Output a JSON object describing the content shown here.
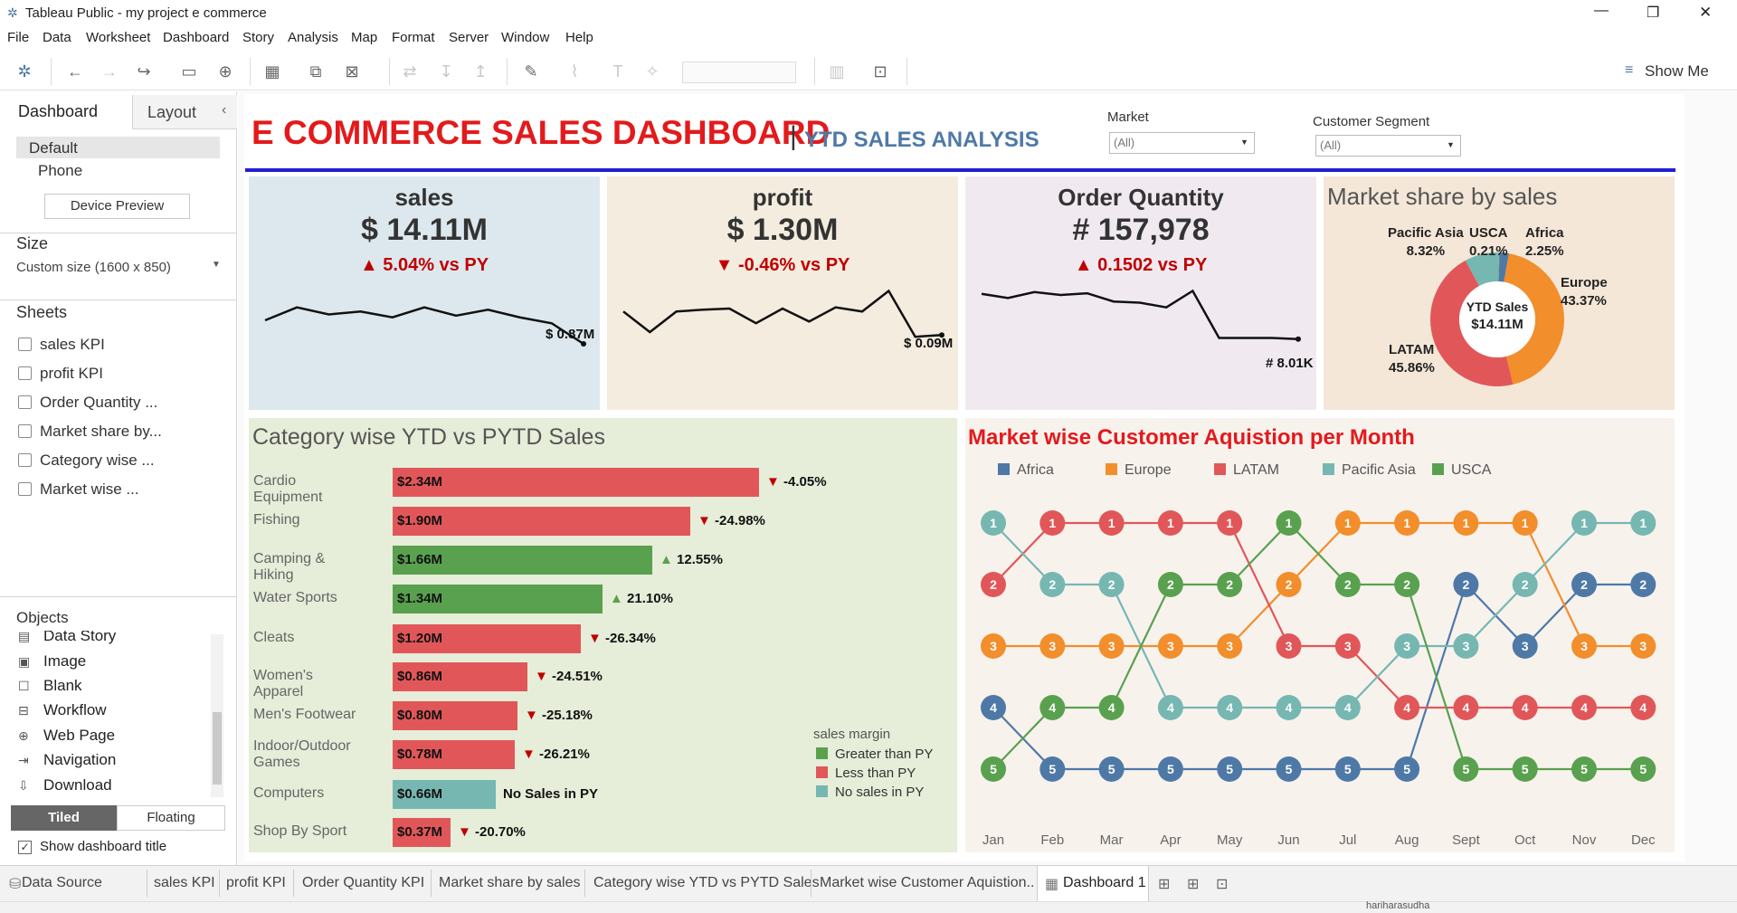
{
  "window": {
    "title": "Tableau Public - my project e commerce",
    "min": "—",
    "restore": "❐",
    "close": "✕"
  },
  "menu": [
    "File",
    "Data",
    "Worksheet",
    "Dashboard",
    "Story",
    "Analysis",
    "Map",
    "Format",
    "Server",
    "Window",
    "Help"
  ],
  "toolbar": {
    "show_me": "Show Me"
  },
  "left": {
    "tab_dashboard": "Dashboard",
    "tab_layout": "Layout",
    "collapse": "‹",
    "device_default": "Default",
    "device_phone": "Phone",
    "device_preview": "Device Preview",
    "size_header": "Size",
    "size_value": "Custom size (1600 x 850)",
    "sheets_header": "Sheets",
    "sheets": [
      "sales KPI",
      "profit KPI",
      "Order Quantity ...",
      "Market share by...",
      "Category wise ...",
      "Market wise ..."
    ],
    "objects_header": "Objects",
    "objects": [
      "Data Story",
      "Image",
      "Blank",
      "Workflow",
      "Web Page",
      "Navigation",
      "Download"
    ],
    "tiled": "Tiled",
    "floating": "Floating",
    "show_title": "Show dashboard title"
  },
  "dashboard": {
    "title": "E COMMERCE SALES DASHBOARD",
    "sep": "|",
    "subtitle": "YTD SALES ANALYSIS",
    "filter_market_label": "Market",
    "filter_market_value": "(All)",
    "filter_segment_label": "Customer Segment",
    "filter_segment_value": "(All)"
  },
  "kpis": [
    {
      "title": "sales",
      "value": "$ 14.11M",
      "delta": "▲ 5.04% vs  PY",
      "end_label": "$ 0.87M",
      "color": "#dde8ee",
      "trend": [
        0.4,
        0.62,
        0.5,
        0.55,
        0.45,
        0.62,
        0.48,
        0.58,
        0.45,
        0.35,
        0.0
      ]
    },
    {
      "title": "profit",
      "value": "$ 1.30M",
      "delta": "▼ -0.46% vs PY",
      "end_label": "$ 0.09M",
      "color": "#f4ecde",
      "trend": [
        0.55,
        0.2,
        0.55,
        0.58,
        0.6,
        0.35,
        0.6,
        0.38,
        0.62,
        0.55,
        0.9,
        0.12,
        0.15
      ]
    },
    {
      "title": "Order Quantity",
      "value": "# 157,978",
      "delta": "▲ 0.1502 vs PY",
      "end_label": "# 8.01K",
      "color": "#f0eaf0",
      "trend": [
        0.85,
        0.78,
        0.88,
        0.83,
        0.86,
        0.72,
        0.7,
        0.62,
        0.9,
        0.1,
        0.1,
        0.1,
        0.08
      ]
    }
  ],
  "market_share": {
    "title": "Market share by sales",
    "center_line1": "YTD Sales",
    "center_line2": "$14.11M",
    "slices": [
      {
        "name": "Africa",
        "pct": "2.25%",
        "value": 2.25,
        "color": "#4e79a7"
      },
      {
        "name": "Europe",
        "pct": "43.37%",
        "value": 43.37,
        "color": "#f28e2b"
      },
      {
        "name": "LATAM",
        "pct": "45.86%",
        "value": 45.86,
        "color": "#e15759"
      },
      {
        "name": "Pacific Asia",
        "pct": "8.32%",
        "value": 8.32,
        "color": "#76b7b2"
      },
      {
        "name": "USCA",
        "pct": "0.21%",
        "value": 0.21,
        "color": "#59a14f"
      }
    ]
  },
  "category": {
    "title": "Category wise YTD vs PYTD Sales",
    "legend_title": "sales margin",
    "legend": [
      {
        "label": "Greater than PY",
        "color": "#59a14f"
      },
      {
        "label": "Less than PY",
        "color": "#e15759"
      },
      {
        "label": "No sales in PY",
        "color": "#76b7b2"
      }
    ]
  },
  "rank": {
    "title": "Market wise Customer Aquistion per Month",
    "months": [
      "Jan",
      "Feb",
      "Mar",
      "Apr",
      "May",
      "Jun",
      "Jul",
      "Aug",
      "Sept",
      "Oct",
      "Nov",
      "Dec"
    ]
  },
  "chart_data": [
    {
      "type": "bar",
      "title": "Category wise YTD vs PYTD Sales",
      "categories": [
        "Cardio Equipment",
        "Fishing",
        "Camping & Hiking",
        "Water Sports",
        "Cleats",
        "Women's Apparel",
        "Men's Footwear",
        "Indoor/Outdoor Games",
        "Computers",
        "Shop By Sport"
      ],
      "values": [
        2.34,
        1.9,
        1.66,
        1.34,
        1.2,
        0.86,
        0.8,
        0.78,
        0.66,
        0.37
      ],
      "labels": [
        "$2.34M",
        "$1.90M",
        "$1.66M",
        "$1.34M",
        "$1.20M",
        "$0.86M",
        "$0.80M",
        "$0.78M",
        "$0.66M",
        "$0.37M"
      ],
      "change": [
        "▼ -4.05%",
        "▼ -24.98%",
        "▲ 12.55%",
        "▲ 21.10%",
        "▼ -26.34%",
        "▼ -24.51%",
        "▼ -25.18%",
        "▼ -26.21%",
        "No Sales in PY",
        "▼ -20.70%"
      ],
      "margin": [
        "less",
        "less",
        "greater",
        "greater",
        "less",
        "less",
        "less",
        "less",
        "none",
        "less"
      ]
    },
    {
      "type": "line",
      "title": "Market wise Customer Aquistion per Month",
      "x": [
        "Jan",
        "Feb",
        "Mar",
        "Apr",
        "May",
        "Jun",
        "Jul",
        "Aug",
        "Sept",
        "Oct",
        "Nov",
        "Dec"
      ],
      "series": [
        {
          "name": "Africa",
          "color": "#4e79a7",
          "values": [
            4,
            5,
            5,
            5,
            5,
            5,
            5,
            5,
            2,
            3,
            2,
            2
          ]
        },
        {
          "name": "Europe",
          "color": "#f28e2b",
          "values": [
            3,
            3,
            3,
            3,
            3,
            2,
            1,
            1,
            1,
            1,
            3,
            3
          ]
        },
        {
          "name": "LATAM",
          "color": "#e15759",
          "values": [
            2,
            1,
            1,
            1,
            1,
            3,
            3,
            4,
            4,
            4,
            4,
            4
          ]
        },
        {
          "name": "Pacific Asia",
          "color": "#76b7b2",
          "values": [
            1,
            2,
            2,
            4,
            4,
            4,
            4,
            3,
            3,
            2,
            1,
            1
          ]
        },
        {
          "name": "USCA",
          "color": "#59a14f",
          "values": [
            5,
            4,
            4,
            2,
            2,
            1,
            2,
            2,
            5,
            5,
            5,
            5
          ]
        }
      ]
    }
  ],
  "tabs": [
    "Data Source",
    "sales KPI",
    "profit KPI",
    "Order Quantity KPI",
    "Market share by sales",
    "Category wise YTD vs PYTD Sales",
    "Market wise Customer Aquistion...",
    "Dashboard 1"
  ],
  "status": {
    "user": "hariharasudha"
  }
}
